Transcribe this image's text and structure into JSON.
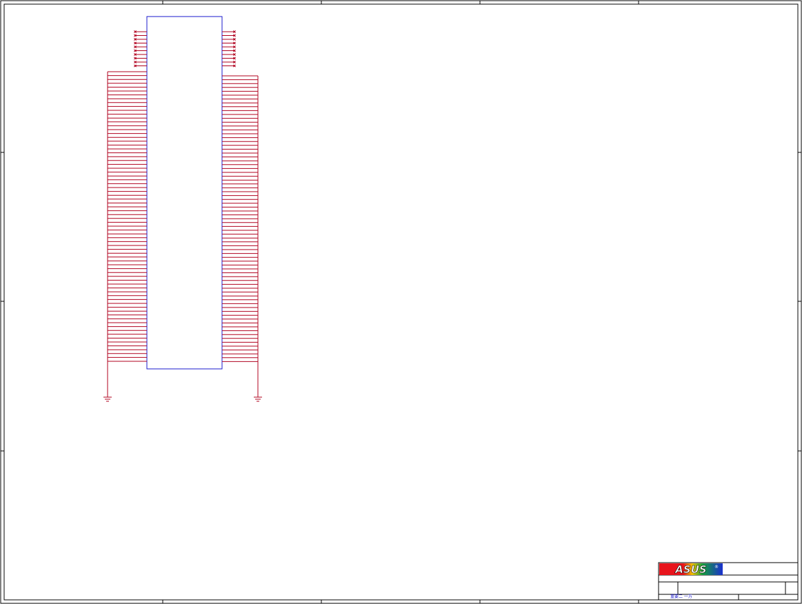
{
  "logo": {
    "text": "ASUS",
    "registered": "®",
    "colors": [
      "#e8141c",
      "#f3c300",
      "#14a03c",
      "#1a2fd0"
    ]
  },
  "title_block": {
    "footer_note": "重要二 一万"
  },
  "schematic": {
    "top_left_nc_pins": 10,
    "top_right_nc_pins": 10,
    "left_ground_pins": 76,
    "right_ground_pins": 75,
    "wire_color": "#b0001e",
    "body_color": "#1a1acc"
  }
}
